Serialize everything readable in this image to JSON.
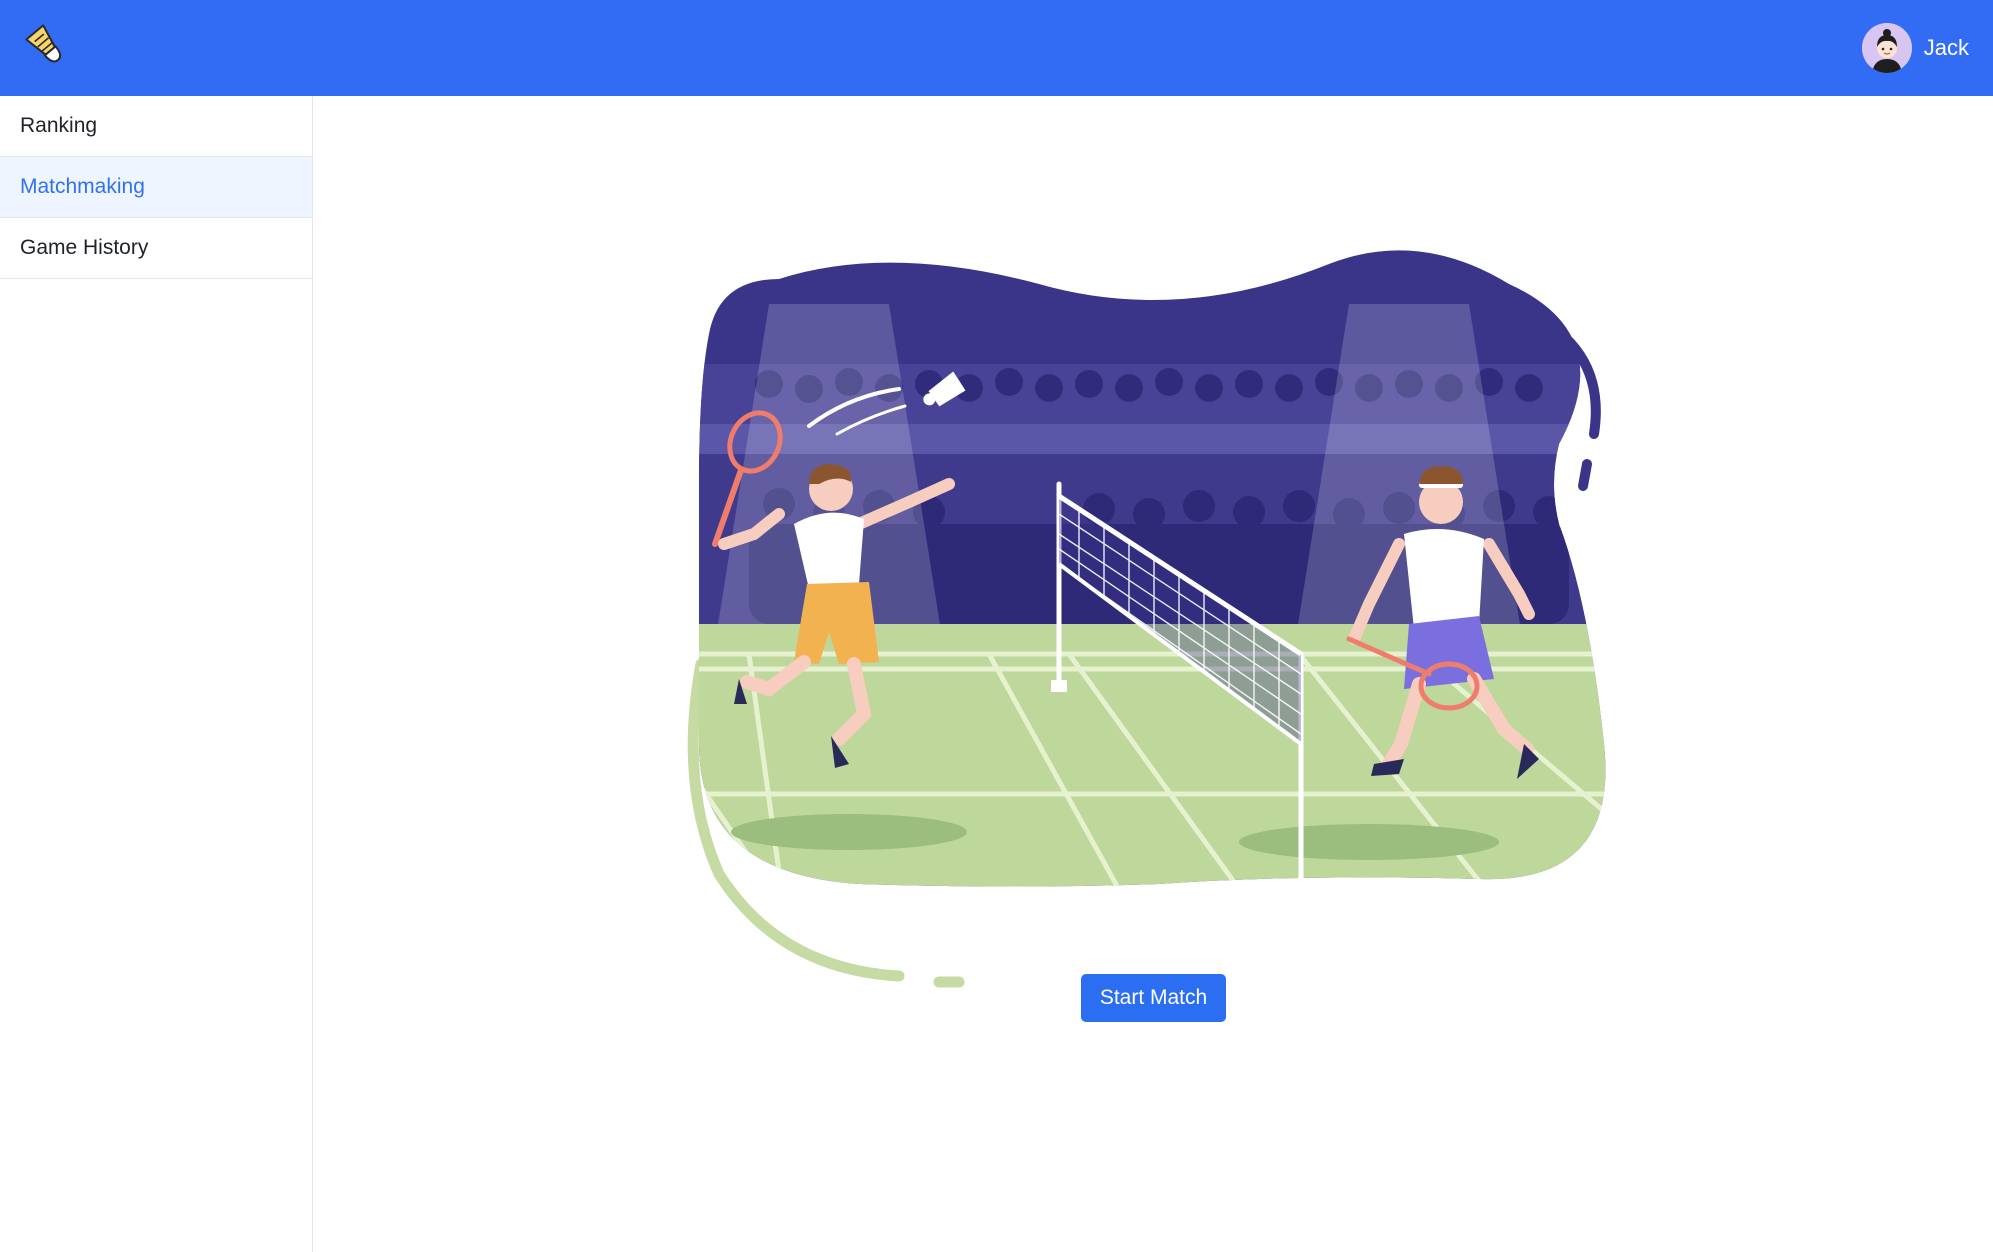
{
  "header": {
    "logo_icon": "shuttlecock-icon",
    "brand_color": "#326cf5",
    "user": {
      "name": "Jack",
      "avatar_icon": "user-avatar-icon"
    }
  },
  "sidebar": {
    "items": [
      {
        "label": "Ranking",
        "active": false
      },
      {
        "label": "Matchmaking",
        "active": true
      },
      {
        "label": "Game History",
        "active": false
      }
    ],
    "active_color": "#3370f0",
    "active_background": "#eef5ff"
  },
  "main": {
    "illustration_icon": "badminton-match-illustration",
    "start_button": {
      "label": "Start Match",
      "color": "#2c6ef2"
    }
  }
}
